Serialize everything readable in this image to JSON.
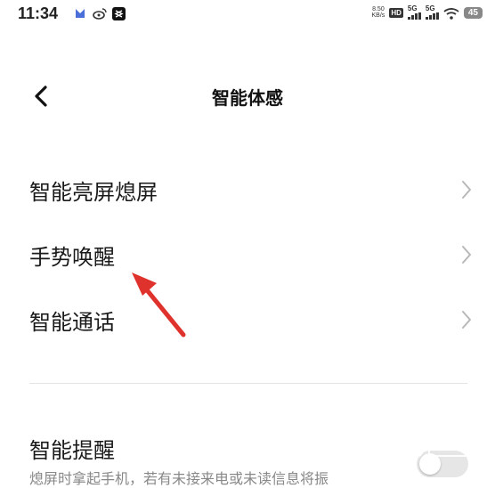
{
  "status_bar": {
    "time": "11:34",
    "net_speed_value": "8.50",
    "net_speed_unit": "KB/s",
    "hd_badge": "HD",
    "signal1": "5G",
    "signal2": "5G",
    "battery": "45"
  },
  "header": {
    "title": "智能体感"
  },
  "menu": {
    "items": [
      {
        "label": "智能亮屏熄屏"
      },
      {
        "label": "手势唤醒"
      },
      {
        "label": "智能通话"
      }
    ]
  },
  "reminder": {
    "title": "智能提醒",
    "description": "熄屏时拿起手机，若有未接来电或未读信息将振",
    "enabled": false
  },
  "colors": {
    "arrow": "#e0322c",
    "toggle_off": "#e6e6e6"
  }
}
